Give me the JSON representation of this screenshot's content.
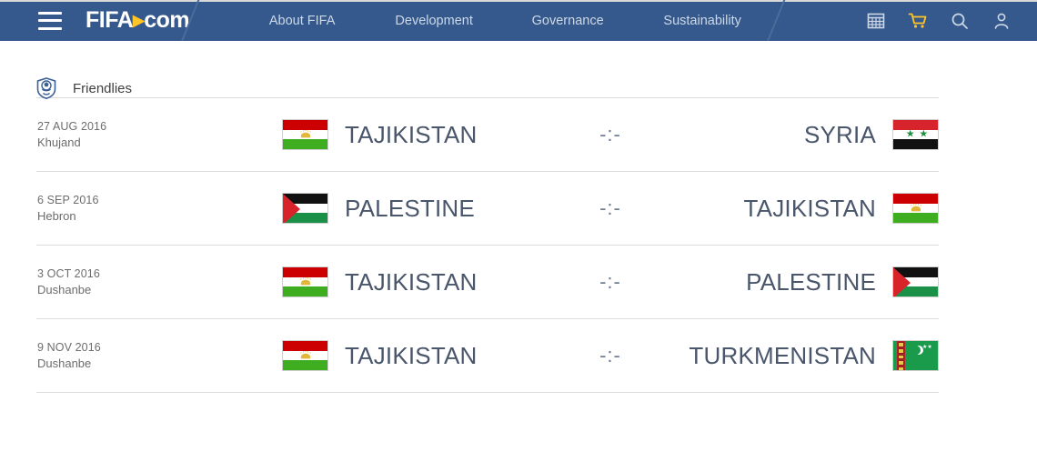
{
  "navbar": {
    "menu_icon": "hamburger-menu-icon",
    "brand": {
      "fifa": "FIFA",
      "dot": "▸",
      "com": "com"
    },
    "links": [
      {
        "label": "About FIFA"
      },
      {
        "label": "Development"
      },
      {
        "label": "Governance"
      },
      {
        "label": "Sustainability"
      }
    ],
    "icons": [
      {
        "name": "calendar-icon"
      },
      {
        "name": "shopping-cart-icon"
      },
      {
        "name": "search-icon"
      },
      {
        "name": "user-account-icon"
      }
    ],
    "colors": {
      "background": "#35598c",
      "link": "#cdd8e6",
      "cart": "#ffc425"
    }
  },
  "section": {
    "icon": "competition-crest-icon",
    "title": "Friendlies"
  },
  "matches": [
    {
      "date": "27 AUG 2016",
      "venue": "Khujand",
      "home": {
        "name": "TAJIKISTAN",
        "flag": "tj"
      },
      "score": "-:-",
      "away": {
        "name": "SYRIA",
        "flag": "sy"
      }
    },
    {
      "date": "6 SEP 2016",
      "venue": "Hebron",
      "home": {
        "name": "PALESTINE",
        "flag": "ps"
      },
      "score": "-:-",
      "away": {
        "name": "TAJIKISTAN",
        "flag": "tj"
      }
    },
    {
      "date": "3 OCT 2016",
      "venue": "Dushanbe",
      "home": {
        "name": "TAJIKISTAN",
        "flag": "tj"
      },
      "score": "-:-",
      "away": {
        "name": "PALESTINE",
        "flag": "ps"
      }
    },
    {
      "date": "9 NOV 2016",
      "venue": "Dushanbe",
      "home": {
        "name": "TAJIKISTAN",
        "flag": "tj"
      },
      "score": "-:-",
      "away": {
        "name": "TURKMENISTAN",
        "flag": "tm"
      }
    }
  ]
}
